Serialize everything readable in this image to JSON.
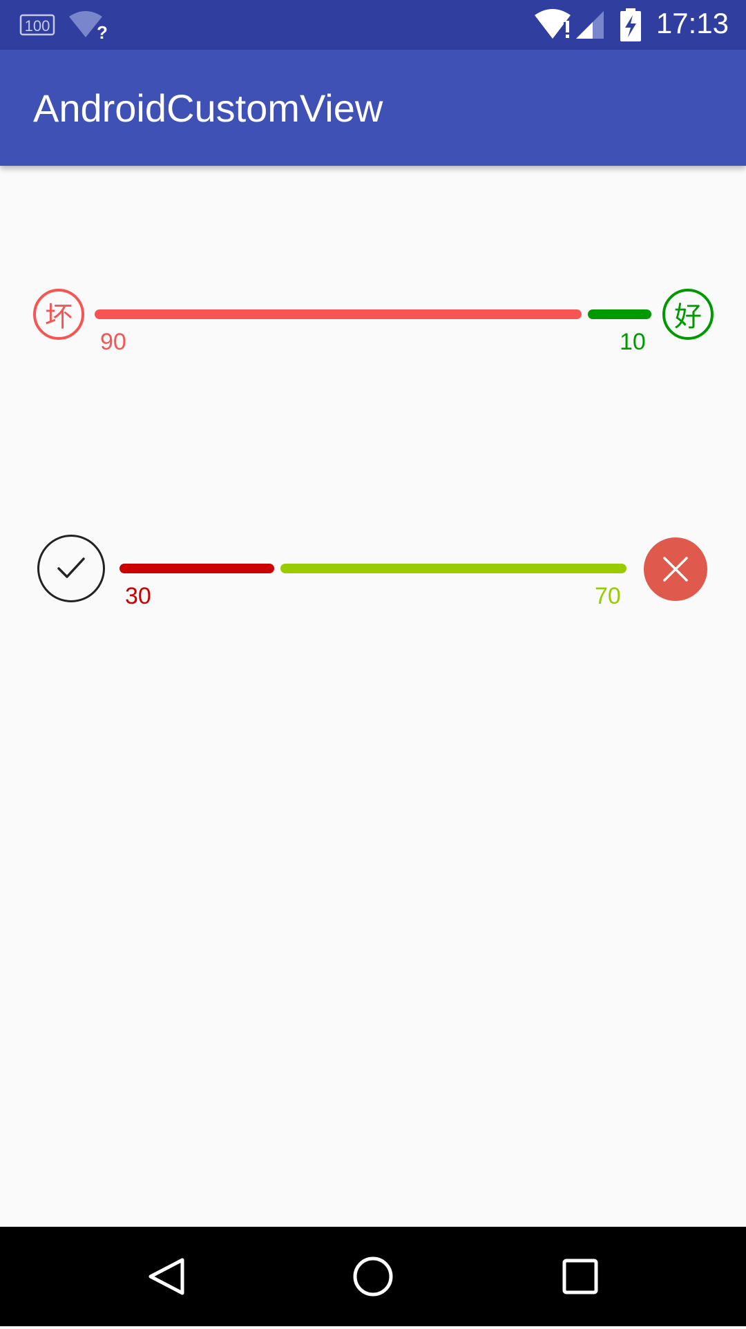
{
  "status_bar": {
    "time": "17:13",
    "battery_badge": "100",
    "wifi_question": "?",
    "icons": [
      "battery-100-icon",
      "wifi-unknown-icon",
      "wifi-alert-icon",
      "cell-signal-icon",
      "battery-charging-icon"
    ]
  },
  "app_bar": {
    "title": "AndroidCustomView"
  },
  "votes": [
    {
      "left_icon": "坏",
      "right_icon": "好",
      "left_value": "90",
      "right_value": "10",
      "left_color": "#f75454",
      "right_color": "#009900"
    },
    {
      "left_icon": "check-icon",
      "right_icon": "close-icon",
      "left_value": "30",
      "right_value": "70",
      "left_color": "#cc0000",
      "right_color": "#99cc00",
      "close_bg_color": "#df5a4c"
    }
  ],
  "nav_bar": {
    "icons": [
      "back-icon",
      "home-icon",
      "recents-icon"
    ]
  }
}
